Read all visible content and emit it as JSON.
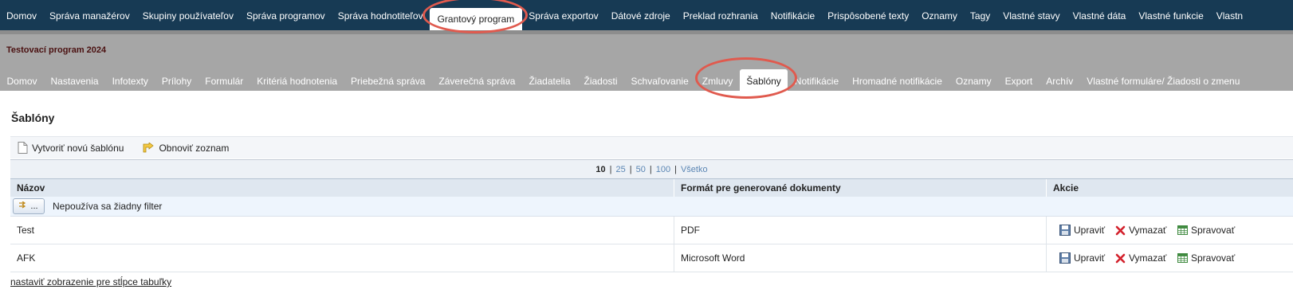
{
  "top_nav": [
    "Domov",
    "Správa manažérov",
    "Skupiny používateľov",
    "Správa programov",
    "Správa hodnotiteľov",
    "Grantový program",
    "Správa exportov",
    "Dátové zdroje",
    "Preklad rozhrania",
    "Notifikácie",
    "Prispôsobené texty",
    "Oznamy",
    "Tagy",
    "Vlastné stavy",
    "Vlastné dáta",
    "Vlastné funkcie",
    "Vlastn"
  ],
  "program_title": "Testovací program 2024",
  "sub_nav": [
    "Domov",
    "Nastavenia",
    "Infotexty",
    "Prílohy",
    "Formulár",
    "Kritériá hodnotenia",
    "Priebežná správa",
    "Záverečná správa",
    "Žiadatelia",
    "Žiadosti",
    "Schvaľovanie",
    "Zmluvy",
    "Šablóny",
    "Notifikácie",
    "Hromadné notifikácie",
    "Oznamy",
    "Export",
    "Archív",
    "Vlastné formuláre/ Žiadosti o zmenu"
  ],
  "page": {
    "title": "Šablóny",
    "toolbar": {
      "create": "Vytvoriť novú šablónu",
      "refresh": "Obnoviť zoznam"
    },
    "pager": {
      "sizes": [
        "10",
        "25",
        "50",
        "100",
        "Všetko"
      ],
      "current": "10"
    },
    "columns": {
      "name": "Názov",
      "format": "Formát pre generované dokumenty",
      "actions": "Akcie"
    },
    "filter": {
      "button": "...",
      "text": "Nepoužíva sa žiadny filter"
    },
    "rows": [
      {
        "name": "Test",
        "format": "PDF"
      },
      {
        "name": "AFK",
        "format": "Microsoft Word"
      }
    ],
    "actions": {
      "edit": "Upraviť",
      "delete": "Vymazať",
      "manage": "Spravovať"
    },
    "footer_link": "nastaviť zobrazenie pre stĺpce tabuľky"
  },
  "colors": {
    "top_nav_bg": "#173a54",
    "sub_nav_bg": "#a6a6a6",
    "highlight": "#e05a4e",
    "program_title": "#4a1010"
  }
}
